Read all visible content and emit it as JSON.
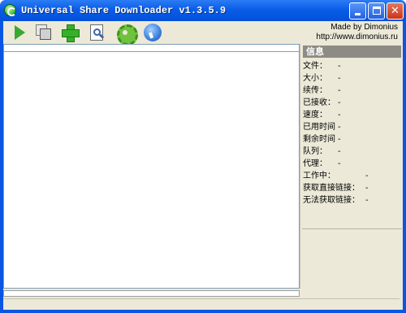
{
  "window": {
    "title": "Universal Share Downloader v1.3.5.9",
    "minimize_label": "",
    "close_label": "✕"
  },
  "toolbar": {
    "buttons": [
      {
        "icon": "play-icon"
      },
      {
        "icon": "copy-icon"
      },
      {
        "icon": "add-icon"
      },
      {
        "icon": "search-doc-icon"
      },
      {
        "icon": "gear-icon"
      },
      {
        "icon": "info-icon"
      }
    ]
  },
  "credits": {
    "author": "Made by Dimonius",
    "url": "http://www.dimonius.ru"
  },
  "info_panel": {
    "title": "信息",
    "rows": [
      {
        "label": "文件：",
        "value": "-"
      },
      {
        "label": "大小：",
        "value": "-"
      },
      {
        "label": "续传：",
        "value": "-"
      },
      {
        "label": "已接收：",
        "value": "-"
      },
      {
        "label": "速度：",
        "value": "-"
      },
      {
        "label": "已用时间",
        "value": "-"
      },
      {
        "label": "剩余时间",
        "value": "-"
      },
      {
        "label": "队列：",
        "value": "-"
      },
      {
        "label": "代理：",
        "value": "-"
      },
      {
        "label": "工作中：",
        "value": "-"
      },
      {
        "label": "获取直接链接：",
        "value": "-"
      },
      {
        "label": "无法获取链接：",
        "value": "-"
      }
    ]
  }
}
